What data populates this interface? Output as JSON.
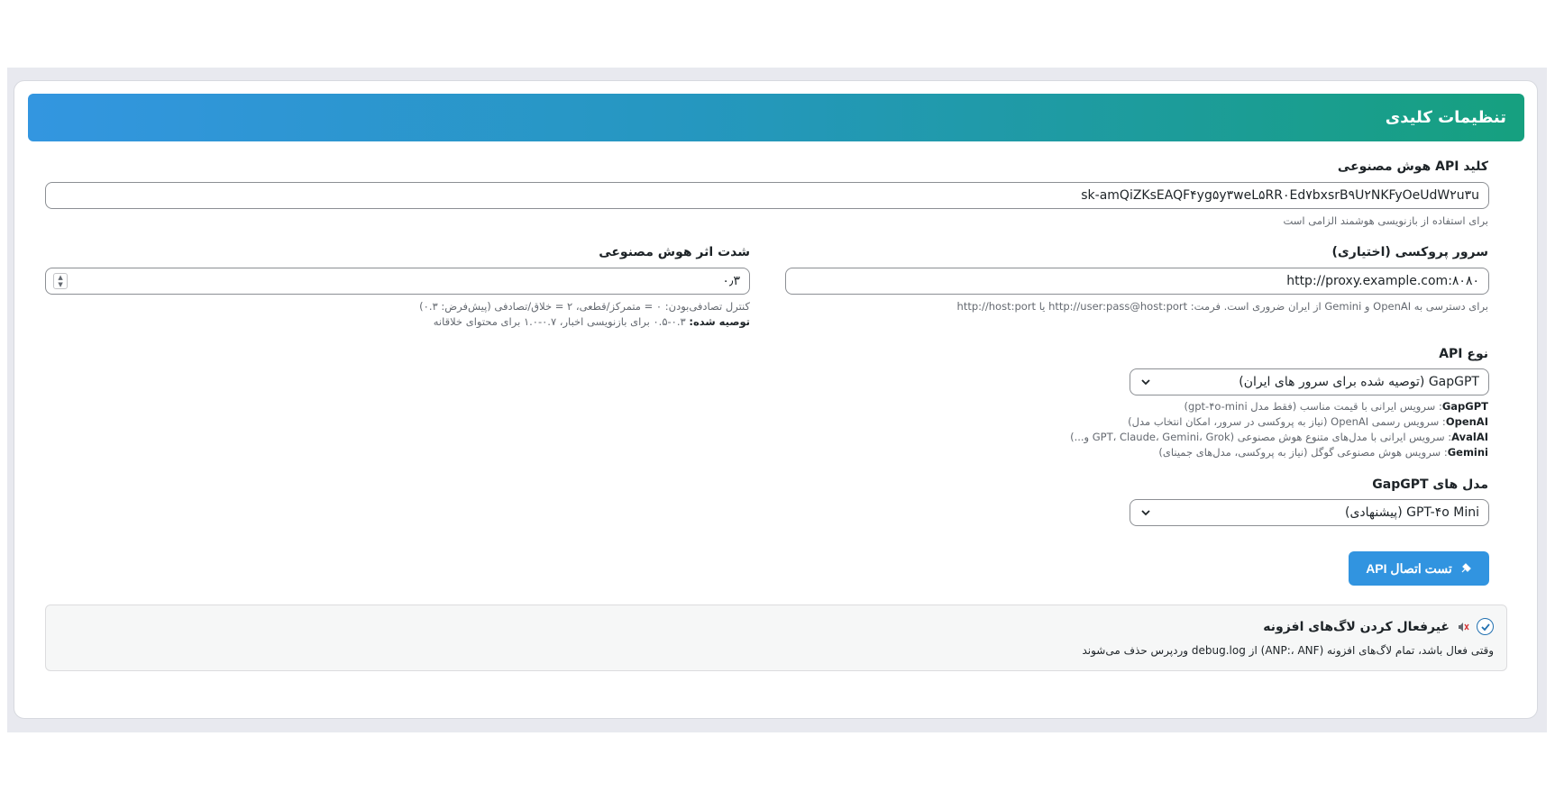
{
  "header": {
    "title": "تنظیمات کلیدی"
  },
  "api_key": {
    "label": "کلید API هوش مصنوعی",
    "value": "sk-amQiZKsEAQF۴yg۵y۳weL۵RR۰Ed۷bxsrB۹U۲NKFyOeUdW۲u۳u",
    "help": "برای استفاده از بازنویسی هوشمند الزامی است"
  },
  "proxy": {
    "label": "سرور پروکسی (اختیاری)",
    "value": "http://proxy.example.com:۸۰۸۰",
    "help": "برای دسترسی به OpenAI و Gemini از ایران ضروری است. فرمت: http://user:pass@host:port یا http://host:port"
  },
  "temperature": {
    "label": "شدت اثر هوش مصنوعی",
    "value": "۰٫۳",
    "help_line1": "کنترل تصادفی‌بودن: ۰ = متمرکز/قطعی، ۲ = خلاق/تصادفی (پیش‌فرض: ۰.۳)",
    "help_line2_bold": "توصیه شده:",
    "help_line2": " ۰.۳-۰.۵ برای بازنویسی اخبار، ۰.۷-۱.۰ برای محتوای خلاقانه"
  },
  "api_type": {
    "label": "نوع API",
    "selected": "GapGPT (توصیه شده برای سرور های ایران)",
    "options_help": [
      {
        "name": "GapGPT",
        "desc": ": سرویس ایرانی با قیمت مناسب (فقط مدل gpt-۴o-mini)"
      },
      {
        "name": "OpenAI",
        "desc": ": سرویس رسمی OpenAI (نیاز به پروکسی در سرور، امکان انتخاب مدل)"
      },
      {
        "name": "AvalAI",
        "desc": ": سرویس ایرانی با مدل‌های متنوع هوش مصنوعی (GPT، Claude، Gemini، Grok و...)"
      },
      {
        "name": "Gemini",
        "desc": ": سرویس هوش مصنوعی گوگل (نیاز به پروکسی، مدل‌های جمینای)"
      }
    ]
  },
  "model": {
    "label": "مدل های GapGPT",
    "selected": "GPT-۴o Mini (پیشنهادی)"
  },
  "test_button": {
    "label": "تست اتصال API"
  },
  "verbose_logs": {
    "title": "غیرفعال کردن لاگ‌های افزونه",
    "description": "وقتی فعال باشد، تمام لاگ‌های افزونه (ANP:، ANF) از debug.log وردپرس حذف می‌شوند",
    "checked": true
  },
  "colors": {
    "accent": "#3194e0",
    "header_start": "#16a07f",
    "header_end": "#3396e0"
  }
}
